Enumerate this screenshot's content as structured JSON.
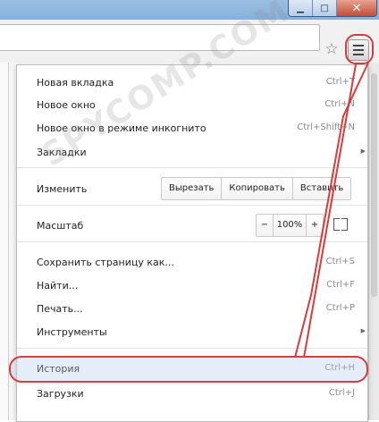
{
  "window": {
    "minimize_glyph": "▁",
    "maximize_glyph": "□",
    "close_glyph": "✕"
  },
  "toolbar": {
    "star_glyph": "☆",
    "menu_icon": "hamburger-icon"
  },
  "menu": {
    "new_tab": {
      "label": "Новая вкладка",
      "shortcut": "Ctrl+T"
    },
    "new_window": {
      "label": "Новое окно",
      "shortcut": "Ctrl+N"
    },
    "incognito": {
      "label": "Новое окно в режиме инкогнито",
      "shortcut": "Ctrl+Shift+N"
    },
    "bookmarks": {
      "label": "Закладки",
      "arrow": "▶"
    },
    "edit": {
      "label": "Изменить",
      "cut": "Вырезать",
      "copy": "Копировать",
      "paste": "Вставить"
    },
    "zoom": {
      "label": "Масштаб",
      "minus": "−",
      "value": "100%",
      "plus": "+"
    },
    "save_page": {
      "label": "Сохранить страницу как...",
      "shortcut": "Ctrl+S"
    },
    "find": {
      "label": "Найти...",
      "shortcut": "Ctrl+F"
    },
    "print": {
      "label": "Печать...",
      "shortcut": "Ctrl+P"
    },
    "tools": {
      "label": "Инструменты",
      "arrow": "▶"
    },
    "history": {
      "label": "История",
      "shortcut": "Ctrl+H"
    },
    "downloads": {
      "label": "Загрузки",
      "shortcut": "Ctrl+J"
    }
  },
  "watermark": "SPYCOMP.COM",
  "colors": {
    "annotation": "#d43d3d",
    "titlebar": "#9bbfe2"
  }
}
